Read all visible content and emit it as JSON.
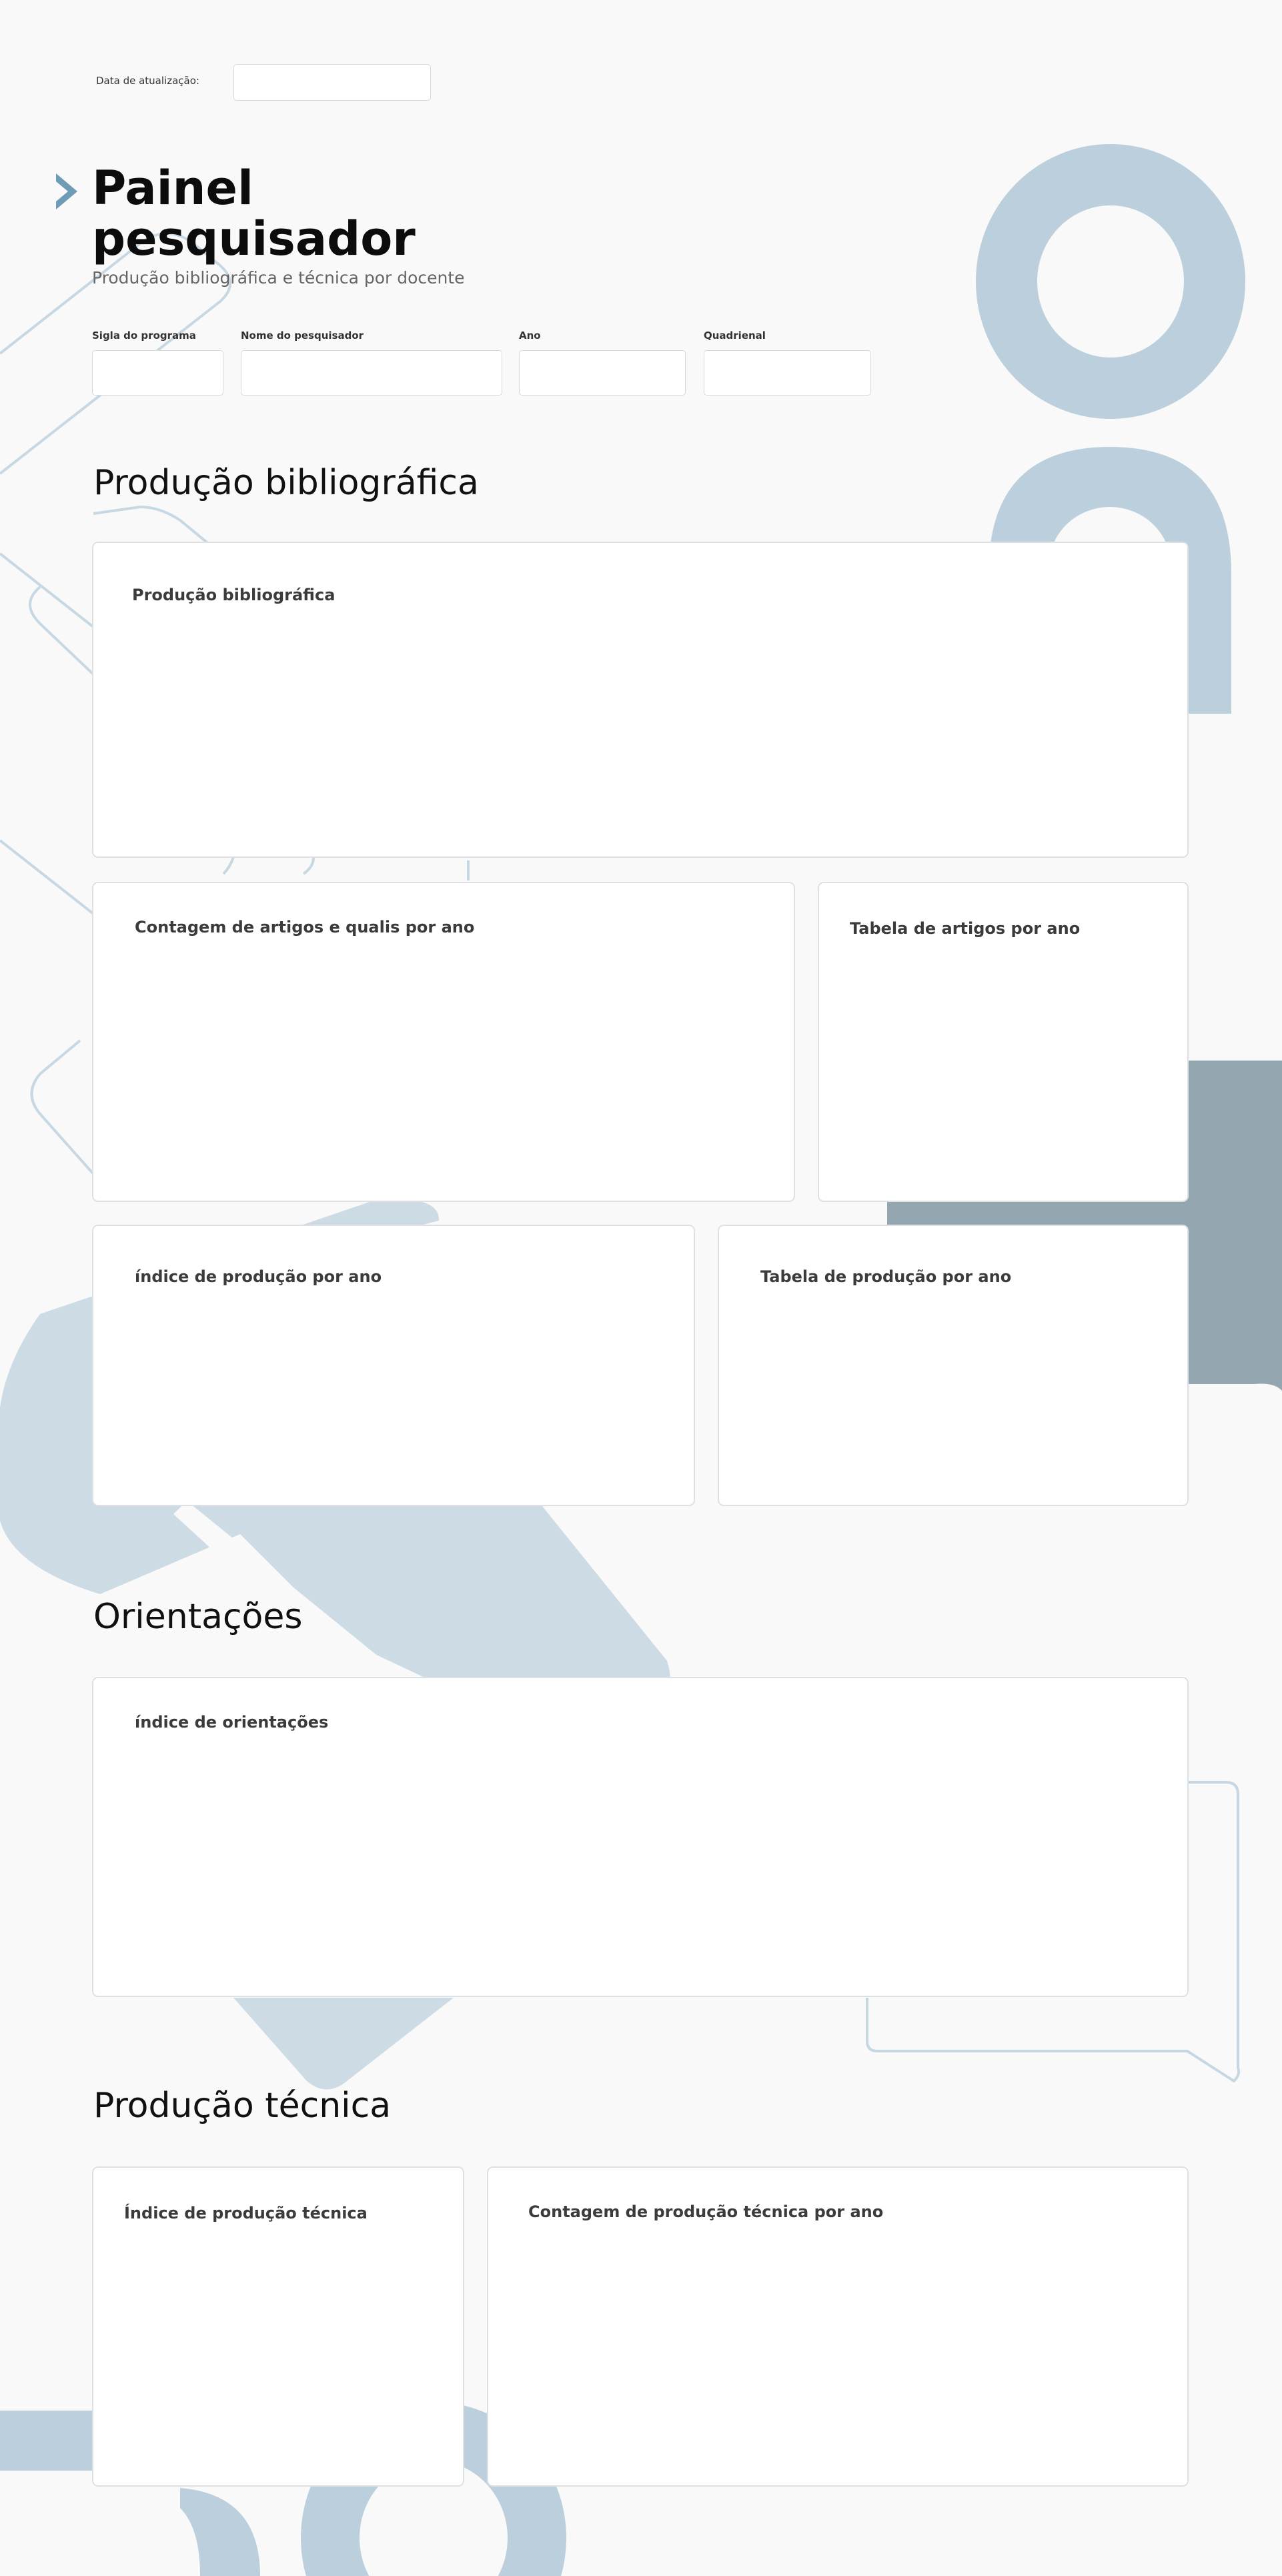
{
  "header": {
    "update_label": "Data de atualização:",
    "update_value": "",
    "title_line1": "Painel",
    "title_line2": "pesquisador",
    "subtitle": "Produção bibliográfica e técnica por docente"
  },
  "filters": [
    {
      "label": "Sigla do programa",
      "value": ""
    },
    {
      "label": "Nome do pesquisador",
      "value": ""
    },
    {
      "label": "Ano",
      "value": ""
    },
    {
      "label": "Quadrienal",
      "value": ""
    }
  ],
  "sections": {
    "bibliografica": {
      "title": "Produção bibliográfica",
      "cards": [
        "Produção bibliográfica",
        "Contagem de artigos e qualis por ano",
        "Tabela de artigos por ano",
        "índice de produção por ano",
        "Tabela de produção por ano"
      ]
    },
    "orientacoes": {
      "title": "Orientações",
      "cards": [
        "índice de orientações"
      ]
    },
    "tecnica": {
      "title": "Produção técnica",
      "cards": [
        "Índice de produção técnica",
        "Contagem de produção técnica por ano"
      ]
    }
  },
  "colors": {
    "background": "#f9f9f9",
    "decor_blue": "#bccfdc",
    "decor_slate": "#94a6b0",
    "chevron": "#6e9bb5"
  },
  "icons": {
    "header_marker": "chevron-right-icon"
  }
}
